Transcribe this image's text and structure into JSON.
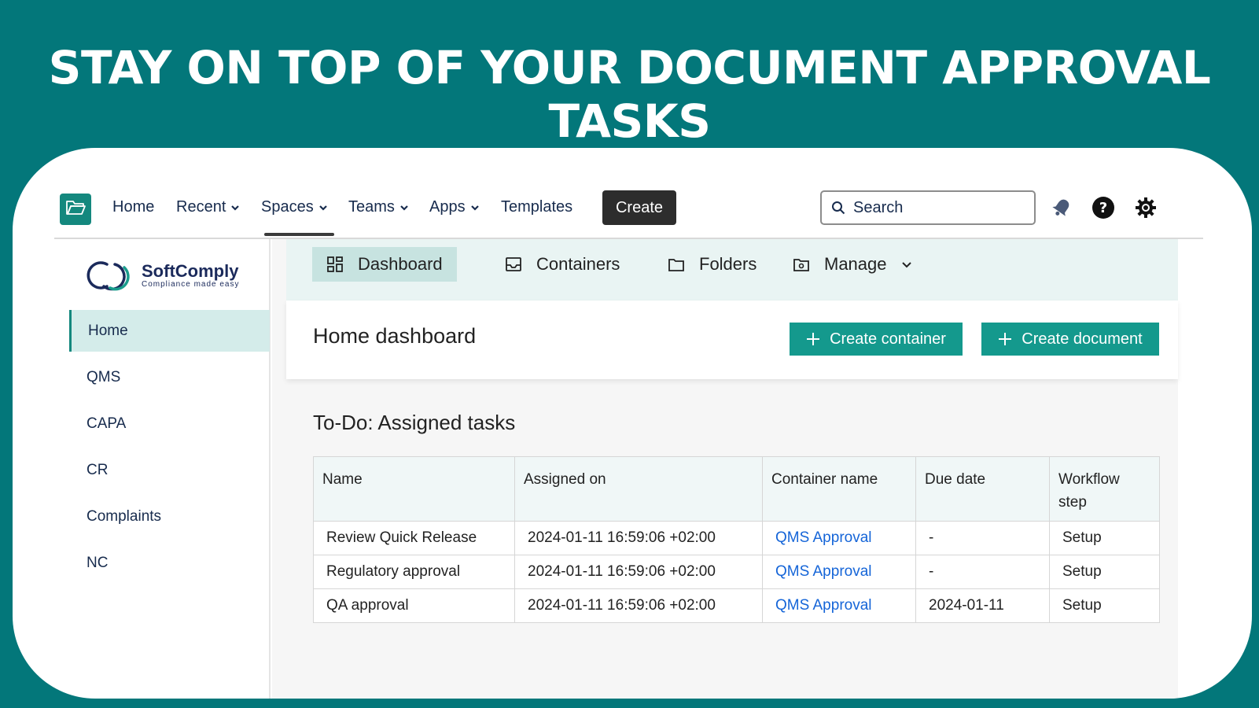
{
  "headline": "STAY ON TOP OF YOUR DOCUMENT APPROVAL TASKS",
  "colors": {
    "background": "#03777a",
    "accent": "#14998d",
    "link": "#1565d8",
    "active_bg": "#d4ecea"
  },
  "topnav": {
    "items": [
      {
        "label": "Home",
        "dropdown": false
      },
      {
        "label": "Recent",
        "dropdown": true
      },
      {
        "label": "Spaces",
        "dropdown": true,
        "active": true
      },
      {
        "label": "Teams",
        "dropdown": true
      },
      {
        "label": "Apps",
        "dropdown": true
      },
      {
        "label": "Templates",
        "dropdown": false
      }
    ],
    "create_label": "Create",
    "search_placeholder": "Search",
    "icons": [
      "folder-open-icon",
      "search-icon",
      "bell-icon",
      "help-icon",
      "gear-icon"
    ]
  },
  "brand": {
    "name": "SoftComply",
    "tagline": "Compliance made easy"
  },
  "sidebar": {
    "items": [
      {
        "label": "Home",
        "active": true
      },
      {
        "label": "QMS"
      },
      {
        "label": "CAPA"
      },
      {
        "label": "CR"
      },
      {
        "label": "Complaints"
      },
      {
        "label": "NC"
      }
    ]
  },
  "subnav": {
    "tabs": [
      {
        "label": "Dashboard",
        "icon": "dashboard-icon",
        "active": true
      },
      {
        "label": "Containers",
        "icon": "inbox-icon"
      },
      {
        "label": "Folders",
        "icon": "folder-icon"
      },
      {
        "label": "Manage",
        "icon": "folder-gear-icon",
        "dropdown": true
      }
    ]
  },
  "main": {
    "title": "Home dashboard",
    "create_container_label": "Create container",
    "create_document_label": "Create document",
    "section_title": "To-Do: Assigned tasks",
    "table": {
      "headers": [
        "Name",
        "Assigned on",
        "Container name",
        "Due date",
        "Workflow step"
      ],
      "rows": [
        [
          "Review Quick Release",
          "2024-01-11 16:59:06 +02:00",
          "QMS Approval",
          "-",
          "Setup"
        ],
        [
          "Regulatory approval",
          "2024-01-11 16:59:06 +02:00",
          "QMS Approval",
          "-",
          "Setup"
        ],
        [
          "QA approval",
          "2024-01-11 16:59:06 +02:00",
          "QMS Approval",
          "2024-01-11",
          "Setup"
        ]
      ]
    }
  }
}
